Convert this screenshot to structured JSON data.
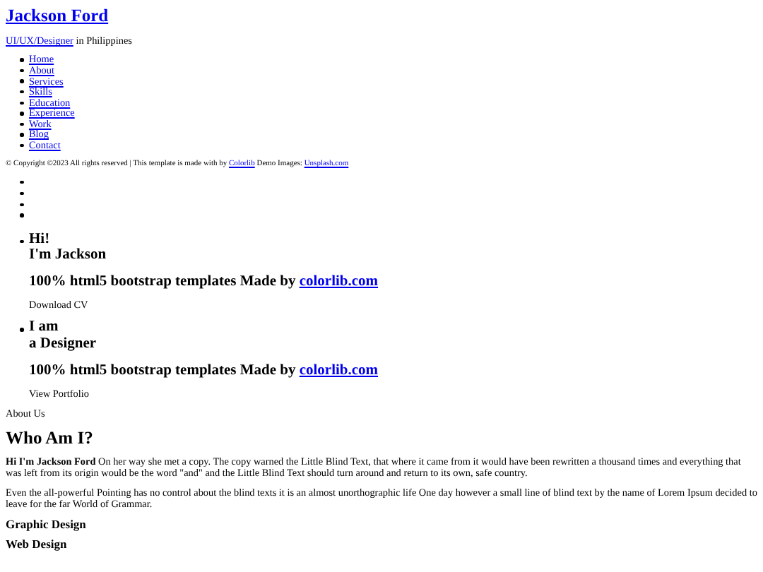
{
  "site": {
    "title": "Jackson Ford",
    "tagline_link": "UI/UX/Designer",
    "tagline_rest": " in Philippines"
  },
  "nav": [
    "Home",
    "About",
    "Services",
    "Skills",
    "Education",
    "Experience",
    "Work",
    "Blog",
    "Contact"
  ],
  "footer": {
    "text": "© Copyright ©2023 All rights reserved | This template is made with by ",
    "link1": "Colorlib",
    "middle": " Demo Images: ",
    "link2": "Unsplash.com"
  },
  "indicators": [
    {
      "kind": "bullet"
    },
    {
      "kind": "bullet"
    },
    {
      "kind": "bullet"
    },
    {
      "kind": "bullet"
    }
  ],
  "slides": [
    {
      "lines": [
        "Hi!",
        "I'm Jackson"
      ],
      "subheading": "100% html5 bootstrap templates Made by ",
      "subheading_link": "colorlib.com",
      "button": "Download CV"
    },
    {
      "lines": [
        "I am",
        "a Designer"
      ],
      "subheading": "100% html5 bootstrap templates Made by ",
      "subheading_link": "colorlib.com",
      "button": "View Portfolio"
    }
  ],
  "about": {
    "label": "About Us",
    "heading": "Who Am I?",
    "paragraphs": [
      "**Hi I'm Jackson Ford** On her way she met a copy. The copy warned the Little Blind Text, that where it came from it would have been rewritten a thousand times and everything that was left from its origin would be the word \"and\" and the Little Blind Text should turn around and return to its own, safe country.",
      "Even the all-powerful Pointing has no control about the blind texts it is an almost unorthographic life One day however a small line of blind text by the name of Lorem Ipsum decided to leave for the far World of Grammar."
    ]
  },
  "services": [
    "Graphic Design",
    "Web Design"
  ]
}
